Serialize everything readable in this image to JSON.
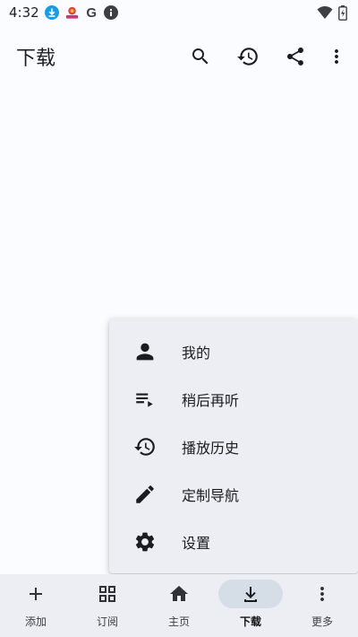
{
  "status_bar": {
    "time": "4:32",
    "icons": [
      "download-notification-icon",
      "app-notification-icon",
      "google-icon",
      "info-icon"
    ],
    "google_letter": "G",
    "right_icons": [
      "wifi-icon",
      "battery-icon"
    ]
  },
  "top_bar": {
    "title": "下载",
    "actions": [
      "search-icon",
      "history-icon",
      "share-icon",
      "more-vert-icon"
    ]
  },
  "menu": {
    "items": [
      {
        "label": "我的",
        "icon": "person-icon"
      },
      {
        "label": "稍后再听",
        "icon": "playlist-play-icon"
      },
      {
        "label": "播放历史",
        "icon": "history-icon"
      },
      {
        "label": "定制导航",
        "icon": "edit-icon"
      },
      {
        "label": "设置",
        "icon": "settings-icon"
      }
    ]
  },
  "bottom_nav": {
    "items": [
      {
        "label": "添加",
        "icon": "add-icon"
      },
      {
        "label": "订阅",
        "icon": "grid-icon"
      },
      {
        "label": "主页",
        "icon": "home-icon"
      },
      {
        "label": "下载",
        "icon": "download-icon",
        "active": true
      },
      {
        "label": "更多",
        "icon": "more-vert-icon"
      }
    ]
  },
  "colors": {
    "background": "#fafcff",
    "surface": "#eceef3",
    "active_pill": "#d5dde6",
    "download_badge": "#1a9be8"
  }
}
